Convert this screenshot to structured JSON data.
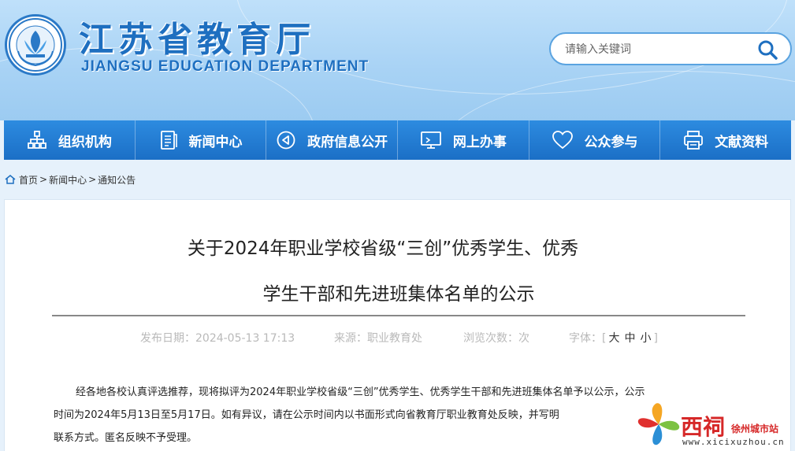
{
  "header": {
    "title": "江苏省教育厅",
    "subtitle": "JIANGSU EDUCATION DEPARTMENT",
    "search_placeholder": "请输入关键词",
    "search_icon": "search-icon",
    "emblem_icon": "education-emblem"
  },
  "colors": {
    "brand_blue": "#1e6fc0",
    "nav_blue": "#2380d6",
    "header_sky": "#a9d3f5",
    "meta_gray": "#b9b9b9",
    "watermark_red": "#d62828"
  },
  "nav": {
    "items": [
      {
        "label": "组织机构",
        "icon": "org-chart-icon"
      },
      {
        "label": "新闻中心",
        "icon": "news-document-icon"
      },
      {
        "label": "政府信息公开",
        "icon": "info-play-icon"
      },
      {
        "label": "网上办事",
        "icon": "monitor-icon"
      },
      {
        "label": "公众参与",
        "icon": "heart-icon"
      },
      {
        "label": "文献资料",
        "icon": "printer-icon"
      }
    ]
  },
  "breadcrumb": {
    "home_icon": "home-icon",
    "items": [
      "首页",
      "新闻中心",
      "通知公告"
    ],
    "separator": ">"
  },
  "article": {
    "title_line1": "关于2024年职业学校省级“三创”优秀学生、优秀",
    "title_line2": "学生干部和先进班集体名单的公示",
    "meta": {
      "publish_date": "发布日期：2024-05-13 17:13",
      "source": "来源：职业教育处",
      "views": "浏览次数：次",
      "font_label": "字体：[",
      "font_large": "大",
      "font_medium": "中",
      "font_small": "小",
      "font_close": "]"
    },
    "body_line1": "经各地各校认真评选推荐，现将拟评为2024年职业学校省级“三创”优秀学生、优秀学生干部和先进班集体名单予以公示，公示",
    "body_line2": "时间为2024年5月13日至5月17日。如有异议，请在公示时间内以书面形式向省教育厅职业教育处反映，并写明",
    "body_line3": "联系方式。匿名反映不予受理。"
  },
  "watermark": {
    "brand": "西祠",
    "city": "徐州城市站",
    "url": "www.xicixuzhou.cn",
    "logo_icon": "pinwheel-logo"
  }
}
